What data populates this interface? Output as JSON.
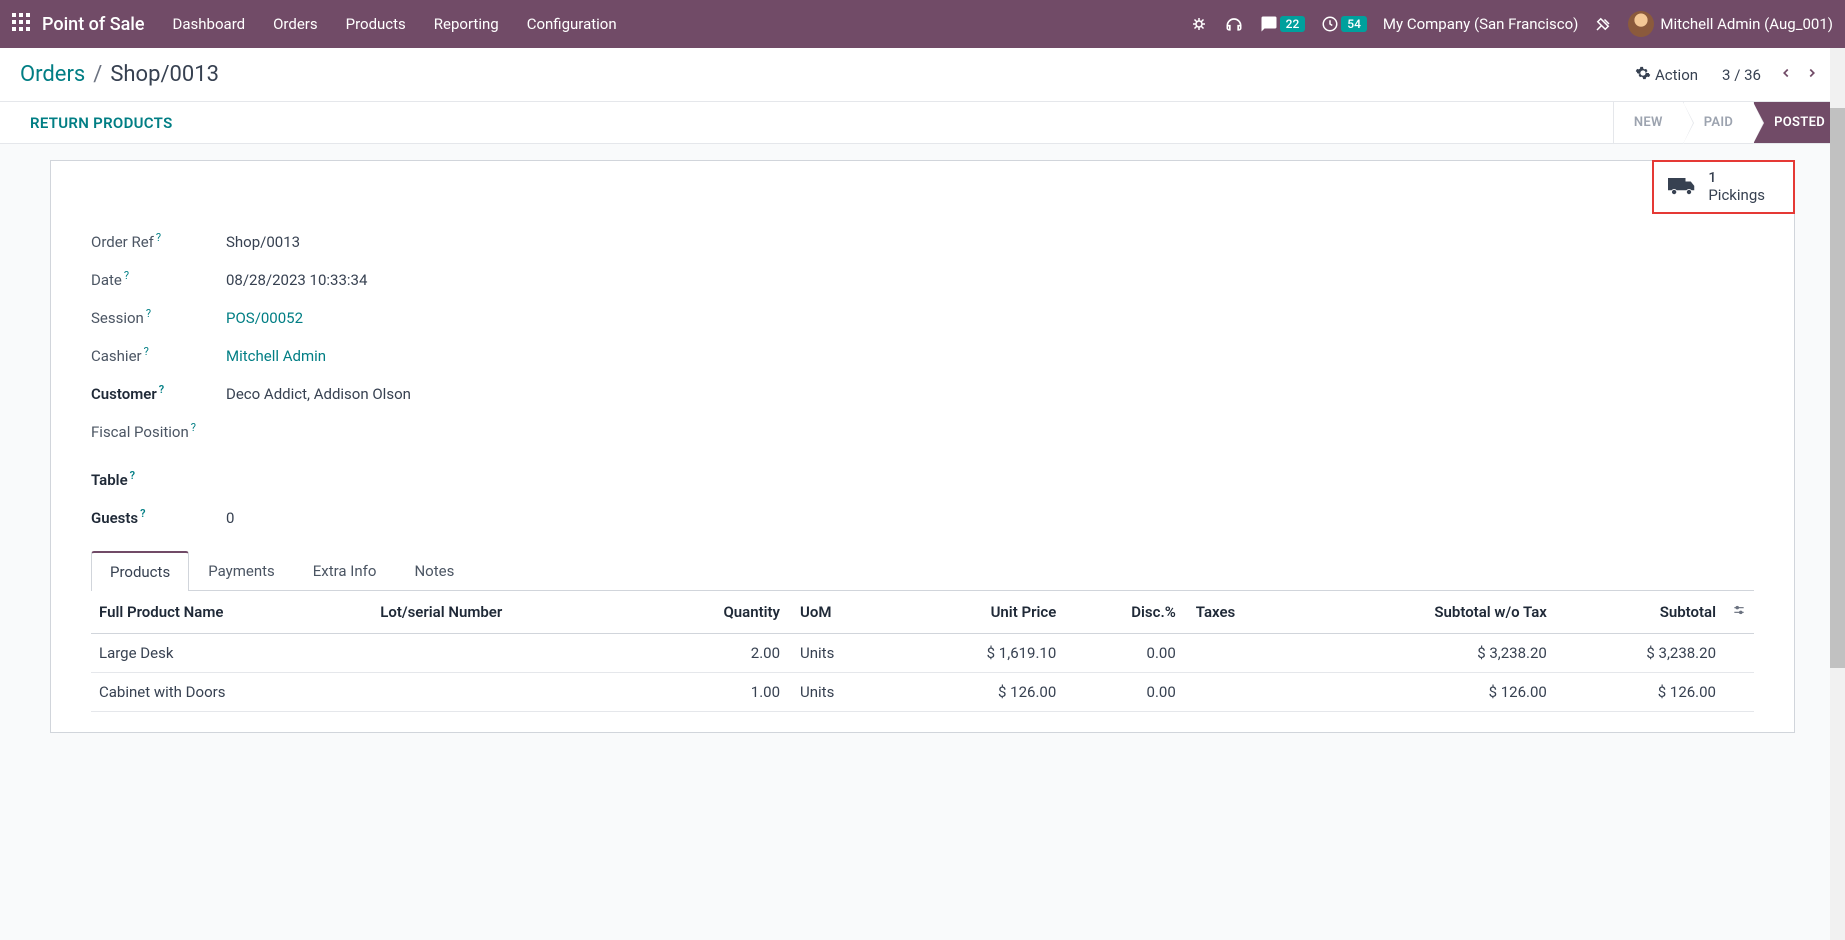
{
  "topbar": {
    "app_title": "Point of Sale",
    "menu": [
      "Dashboard",
      "Orders",
      "Products",
      "Reporting",
      "Configuration"
    ],
    "messages_badge": "22",
    "activities_badge": "54",
    "company": "My Company (San Francisco)",
    "user": "Mitchell Admin (Aug_001)"
  },
  "breadcrumb": {
    "parent": "Orders",
    "current": "Shop/0013",
    "action_label": "Action",
    "pager_current": "3",
    "pager_total": "36"
  },
  "subheader": {
    "return_label": "RETURN PRODUCTS",
    "statuses": [
      "NEW",
      "PAID",
      "POSTED"
    ],
    "active_status_index": 2
  },
  "stat_button": {
    "count": "1",
    "label": "Pickings"
  },
  "fields": {
    "order_ref": {
      "label": "Order Ref",
      "value": "Shop/0013",
      "help": true
    },
    "date": {
      "label": "Date",
      "value": "08/28/2023 10:33:34",
      "help": true
    },
    "session": {
      "label": "Session",
      "value": "POS/00052",
      "help": true,
      "link": true
    },
    "cashier": {
      "label": "Cashier",
      "value": "Mitchell Admin",
      "help": true,
      "link": true
    },
    "customer": {
      "label": "Customer",
      "value": "Deco Addict, Addison Olson",
      "help": true,
      "bold": true
    },
    "fiscal_position": {
      "label": "Fiscal Position",
      "value": "",
      "help": true
    },
    "table": {
      "label": "Table",
      "value": "",
      "help": true,
      "bold": true
    },
    "guests": {
      "label": "Guests",
      "value": "0",
      "help": true,
      "bold": true
    }
  },
  "tabs": [
    "Products",
    "Payments",
    "Extra Info",
    "Notes"
  ],
  "active_tab_index": 0,
  "table": {
    "headers": [
      "Full Product Name",
      "Lot/serial Number",
      "Quantity",
      "UoM",
      "Unit Price",
      "Disc.%",
      "Taxes",
      "Subtotal w/o Tax",
      "Subtotal"
    ],
    "rows": [
      {
        "name": "Large Desk",
        "lot": "",
        "qty": "2.00",
        "uom": "Units",
        "unit_price": "$ 1,619.10",
        "disc": "0.00",
        "taxes": "",
        "subtotal_wo": "$ 3,238.20",
        "subtotal": "$ 3,238.20"
      },
      {
        "name": "Cabinet with Doors",
        "lot": "",
        "qty": "1.00",
        "uom": "Units",
        "unit_price": "$ 126.00",
        "disc": "0.00",
        "taxes": "",
        "subtotal_wo": "$ 126.00",
        "subtotal": "$ 126.00"
      }
    ]
  }
}
